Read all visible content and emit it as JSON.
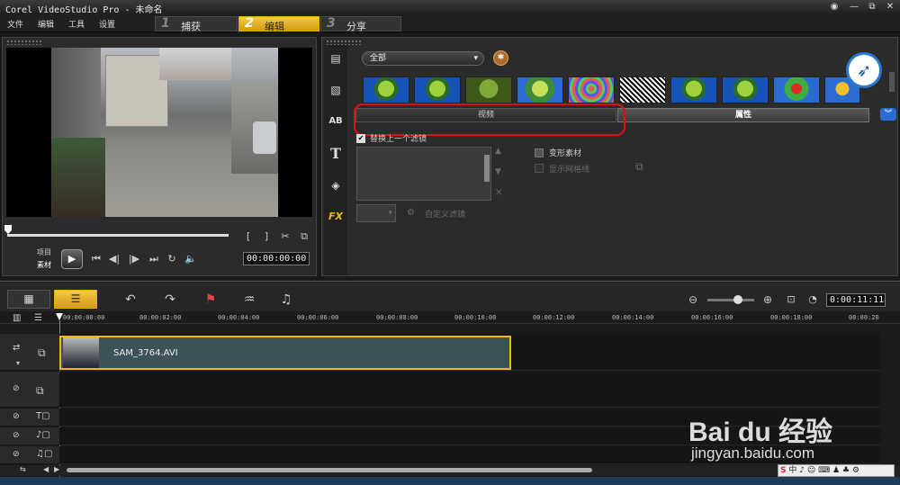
{
  "app": {
    "title": "Corel VideoStudio Pro - 未命名"
  },
  "menu": [
    "文件",
    "编辑",
    "工具",
    "设置"
  ],
  "steps": [
    {
      "num": "1",
      "label": "捕获",
      "active": false
    },
    {
      "num": "2",
      "label": "编辑",
      "active": true
    },
    {
      "num": "3",
      "label": "分享",
      "active": false
    }
  ],
  "preview": {
    "project_label": "项目",
    "clip_label": "素材",
    "timecode": "00:00:00:00"
  },
  "library": {
    "category": "全部",
    "tab_video": "视频",
    "tab_properties": "属性",
    "replace_filter_label": "替换上一个滤镜",
    "custom_filter_label": "自定义滤镜",
    "transform_clip_label": "变形素材",
    "show_grid_label": "显示网格线",
    "side_icons": [
      "media-icon",
      "transition-icon",
      "title-icon",
      "text-icon",
      "graphic-icon",
      "fx-icon"
    ],
    "fx_label": "FX",
    "ab_label": "AB",
    "text_label": "T"
  },
  "timeline": {
    "timecode": "0:00:11:11",
    "ruler": [
      "00:00:00:00",
      "00:00:02:00",
      "00:00:04:00",
      "00:00:06:00",
      "00:00:08:00",
      "00:00:10:00",
      "00:00:12:00",
      "00:00:14:00",
      "00:00:16:00",
      "00:00:18:00",
      "00:00:20"
    ],
    "clip_name": "SAM_3764.AVI"
  },
  "watermark": {
    "brand": "Bai du 经验",
    "url": "jingyan.baidu.com"
  },
  "accent": "#f0b90b",
  "highlight": "#e01010"
}
